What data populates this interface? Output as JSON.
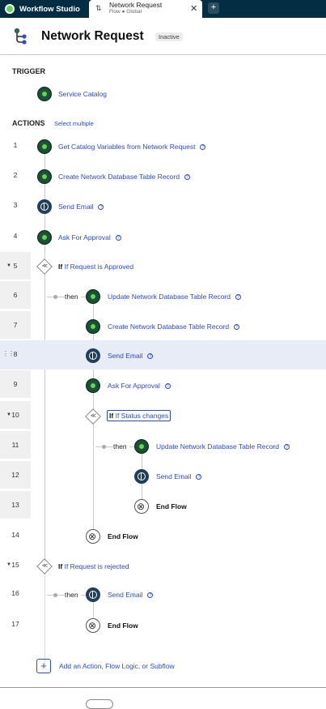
{
  "app": {
    "name": "Workflow Studio"
  },
  "tab": {
    "title": "Network Request",
    "subtitle": "Flow ● Global",
    "close": "✕"
  },
  "new_tab": "+",
  "header": {
    "title": "Network Request",
    "status": "Inactive"
  },
  "trigger": {
    "heading": "TRIGGER",
    "label": "Service Catalog"
  },
  "actions": {
    "heading": "ACTIONS",
    "select_multiple": "Select multiple"
  },
  "steps": [
    {
      "num": "1",
      "label": "Get Catalog Variables from Network Request"
    },
    {
      "num": "2",
      "label": "Create Network Database Table Record"
    },
    {
      "num": "3",
      "label": "Send Email"
    },
    {
      "num": "4",
      "label": "Ask For Approval"
    },
    {
      "num": "5",
      "kw": "If",
      "label": "If Request is Approved"
    },
    {
      "num": "6",
      "label": "Update Network Database Table Record"
    },
    {
      "num": "7",
      "label": "Create Network Database Table Record"
    },
    {
      "num": "8",
      "label": "Send Email"
    },
    {
      "num": "9",
      "label": "Ask For Approval"
    },
    {
      "num": "10",
      "kw": "If",
      "label": "If Status changes"
    },
    {
      "num": "11",
      "label": "Update Network Database Table Record"
    },
    {
      "num": "12",
      "label": "Send Email"
    },
    {
      "num": "13",
      "label": "End Flow"
    },
    {
      "num": "14",
      "label": "End Flow"
    },
    {
      "num": "15",
      "kw": "If",
      "label": "If Request is rejected"
    },
    {
      "num": "16",
      "label": "Send Email"
    },
    {
      "num": "17",
      "label": "End Flow"
    }
  ],
  "then_label": "then",
  "add_label": "Add an Action, Flow Logic, or Subflow",
  "colors": {
    "accent": "#2b4bd1",
    "topbar": "#032d42",
    "highlight": "#e8ecf6",
    "node_green": "#62d84e"
  }
}
